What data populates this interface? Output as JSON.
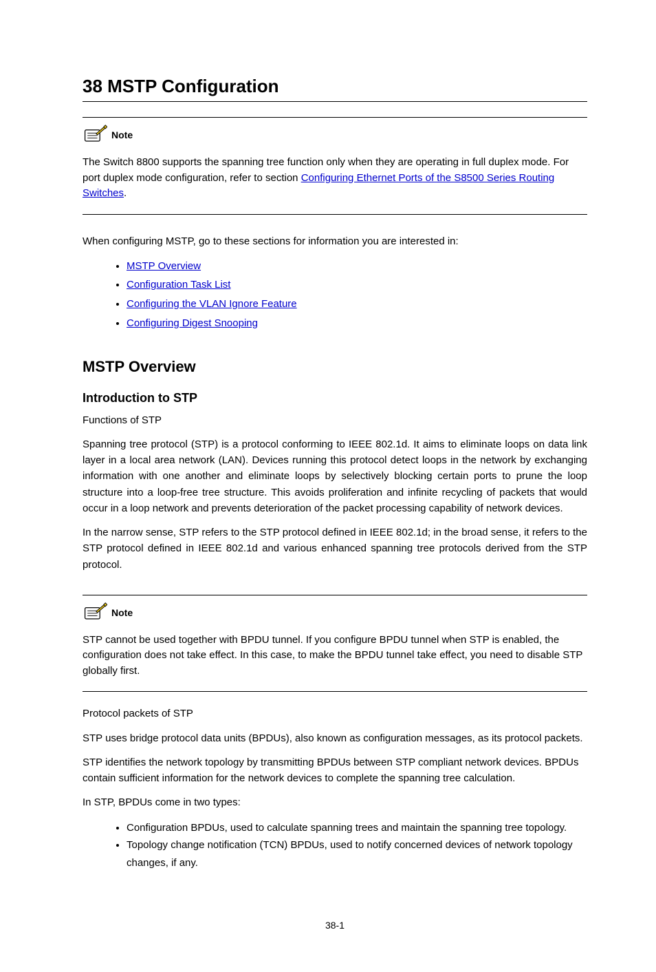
{
  "chapter": {
    "number": "38",
    "title": "MSTP Configuration"
  },
  "note1": {
    "label": "Note",
    "text_a": "The Switch 8800 supports the spanning tree function only when they are operating in full duplex mode. For port duplex mode configuration, refer to section ",
    "link_text": "Configuring Ethernet Ports of the S8500 Series Routing Switches",
    "text_b": "."
  },
  "toc": {
    "intro": "When configuring MSTP, go to these sections for information you are interested in:",
    "items": [
      "MSTP Overview",
      "Configuration Task List",
      "Configuring the VLAN Ignore Feature",
      "Configuring Digest Snooping"
    ]
  },
  "section1": {
    "title": "MSTP Overview",
    "sub_title": "Introduction to STP",
    "funcs_heading": "Functions of STP",
    "p1": "Spanning tree protocol (STP) is a protocol conforming to IEEE 802.1d. It aims to eliminate loops on data link layer in a local area network (LAN). Devices running this protocol detect loops in the network by exchanging information with one another and eliminate loops by selectively blocking certain ports to prune the loop structure into a loop-free tree structure. This avoids proliferation and infinite recycling of packets that would occur in a loop network and prevents deterioration of the packet processing capability of network devices.",
    "p2": "In the narrow sense, STP refers to the STP protocol defined in IEEE 802.1d; in the broad sense, it refers to the STP protocol defined in IEEE 802.1d and various enhanced spanning tree protocols derived from the STP protocol."
  },
  "note2": {
    "label": "Note",
    "text": "STP cannot be used together with BPDU tunnel. If you configure BPDU tunnel when STP is enabled, the configuration does not take effect. In this case, to make the BPDU tunnel take effect, you need to disable STP globally first."
  },
  "section2": {
    "heading": "Protocol packets of STP",
    "p1": "STP uses bridge protocol data units (BPDUs), also known as configuration messages, as its protocol packets.",
    "p2": "STP identifies the network topology by transmitting BPDUs between STP compliant network devices. BPDUs contain sufficient information for the network devices to complete the spanning tree calculation.",
    "p3": "In STP, BPDUs come in two types:",
    "bullets": [
      "Configuration BPDUs, used to calculate spanning trees and maintain the spanning tree topology.",
      "Topology change notification (TCN) BPDUs, used to notify concerned devices of network topology changes, if any."
    ]
  },
  "page_number": "38-1"
}
